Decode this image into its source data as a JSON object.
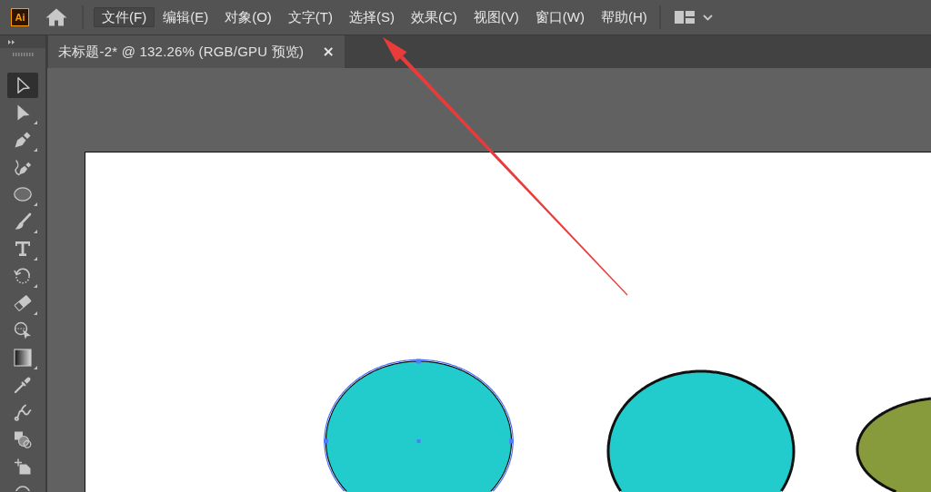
{
  "app": {
    "logo": "Ai"
  },
  "menu": [
    {
      "label": "文件(F)",
      "selected": true
    },
    {
      "label": "编辑(E)",
      "selected": false
    },
    {
      "label": "对象(O)",
      "selected": false
    },
    {
      "label": "文字(T)",
      "selected": false
    },
    {
      "label": "选择(S)",
      "selected": false
    },
    {
      "label": "效果(C)",
      "selected": false
    },
    {
      "label": "视图(V)",
      "selected": false
    },
    {
      "label": "窗口(W)",
      "selected": false
    },
    {
      "label": "帮助(H)",
      "selected": false
    }
  ],
  "tools": [
    {
      "kind": "selection",
      "selected": true,
      "flyout": false
    },
    {
      "kind": "direct-selection",
      "selected": false,
      "flyout": true
    },
    {
      "kind": "pen",
      "selected": false,
      "flyout": true
    },
    {
      "kind": "curvature",
      "selected": false,
      "flyout": false
    },
    {
      "kind": "ellipse",
      "selected": false,
      "flyout": true
    },
    {
      "kind": "paintbrush",
      "selected": false,
      "flyout": true
    },
    {
      "kind": "type",
      "selected": false,
      "flyout": true
    },
    {
      "kind": "rotate",
      "selected": false,
      "flyout": true
    },
    {
      "kind": "eraser",
      "selected": false,
      "flyout": true
    },
    {
      "kind": "shape-builder",
      "selected": false,
      "flyout": false
    },
    {
      "kind": "gradient",
      "selected": false,
      "flyout": true
    },
    {
      "kind": "eyedropper",
      "selected": false,
      "flyout": false
    },
    {
      "kind": "puppet-warp",
      "selected": false,
      "flyout": false
    },
    {
      "kind": "shapes",
      "selected": false,
      "flyout": false
    },
    {
      "kind": "artboard",
      "selected": false,
      "flyout": false
    },
    {
      "kind": "zoom",
      "selected": false,
      "flyout": false
    }
  ],
  "document_tab": {
    "title": "未标题-2* @ 132.26% (RGB/GPU 预览)",
    "close": "×"
  },
  "artboard": {
    "shapes": [
      {
        "kind": "ellipse",
        "color": "#22cccc",
        "selected": true
      },
      {
        "kind": "ellipse",
        "color": "#22cccc",
        "selected": false
      },
      {
        "kind": "ellipse",
        "color": "#879a3c",
        "selected": false
      }
    ]
  }
}
